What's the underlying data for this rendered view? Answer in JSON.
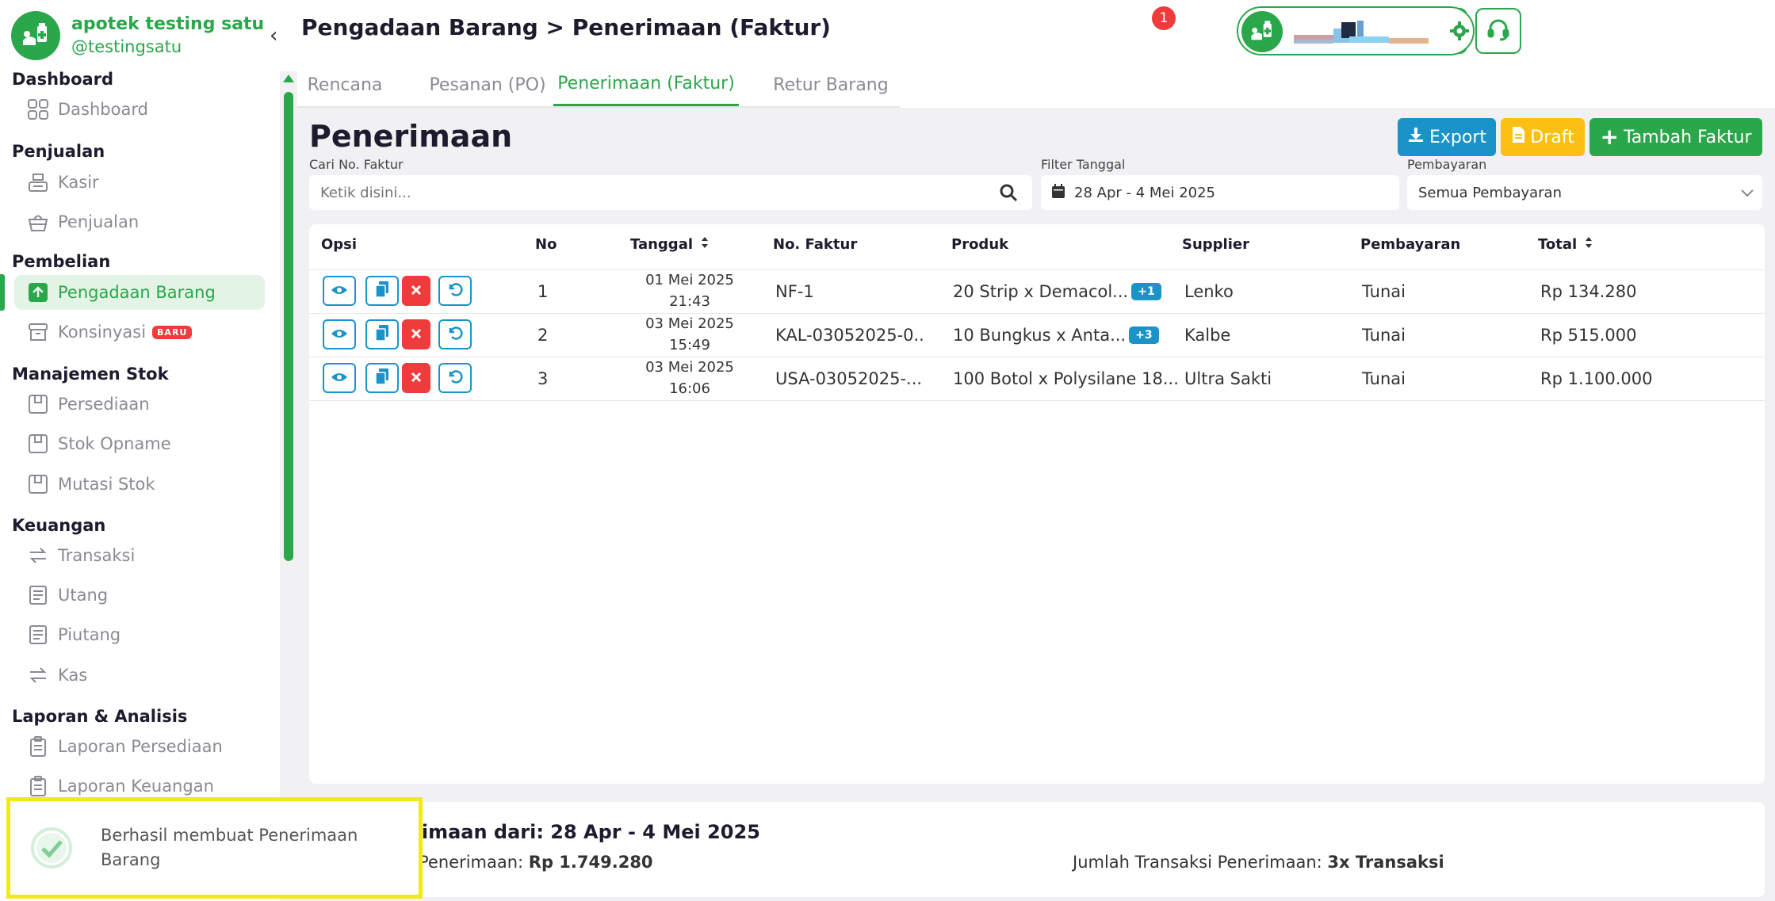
{
  "brand": {
    "name": "apotek testing satu",
    "handle": "@testingsatu"
  },
  "sidebar": {
    "sections": [
      {
        "title": "Dashboard",
        "items": [
          {
            "label": "Dashboard"
          }
        ]
      },
      {
        "title": "Penjualan",
        "items": [
          {
            "label": "Kasir"
          },
          {
            "label": "Penjualan"
          }
        ]
      },
      {
        "title": "Pembelian",
        "items": [
          {
            "label": "Pengadaan Barang",
            "active": true
          },
          {
            "label": "Konsinyasi",
            "badge": "BARU"
          }
        ]
      },
      {
        "title": "Manajemen Stok",
        "items": [
          {
            "label": "Persediaan"
          },
          {
            "label": "Stok Opname"
          },
          {
            "label": "Mutasi Stok"
          }
        ]
      },
      {
        "title": "Keuangan",
        "items": [
          {
            "label": "Transaksi"
          },
          {
            "label": "Utang"
          },
          {
            "label": "Piutang"
          },
          {
            "label": "Kas"
          }
        ]
      },
      {
        "title": "Laporan & Analisis",
        "items": [
          {
            "label": "Laporan Persediaan"
          },
          {
            "label": "Laporan Keuangan"
          }
        ]
      }
    ]
  },
  "header": {
    "breadcrumb": "Pengadaan Barang > Penerimaan (Faktur)",
    "notification_count": "1"
  },
  "tabs": [
    {
      "label": "Rencana"
    },
    {
      "label": "Pesanan (PO)"
    },
    {
      "label": "Penerimaan (Faktur)",
      "active": true
    },
    {
      "label": "Retur Barang"
    }
  ],
  "page": {
    "title": "Penerimaan",
    "actions": {
      "export": "Export",
      "draft": "Draft",
      "add": "Tambah Faktur"
    },
    "filters": {
      "search_label": "Cari No. Faktur",
      "search_placeholder": "Ketik disini...",
      "date_label": "Filter Tanggal",
      "date_value": "28 Apr - 4 Mei 2025",
      "payment_label": "Pembayaran",
      "payment_value": "Semua Pembayaran"
    }
  },
  "table": {
    "columns": [
      "Opsi",
      "No",
      "Tanggal",
      "No. Faktur",
      "Produk",
      "Supplier",
      "Pembayaran",
      "Total"
    ],
    "rows": [
      {
        "no": "1",
        "date": "01 Mei 2025",
        "time": "21:43",
        "invoice": "NF-1",
        "product": "20 Strip x Demacol...",
        "extra": "+1",
        "supplier": "Lenko",
        "payment": "Tunai",
        "total": "Rp 134.280"
      },
      {
        "no": "2",
        "date": "03 Mei 2025",
        "time": "15:49",
        "invoice": "KAL-03052025-0...",
        "product": "10 Bungkus x Anta...",
        "extra": "+3",
        "supplier": "Kalbe",
        "payment": "Tunai",
        "total": "Rp 515.000"
      },
      {
        "no": "3",
        "date": "03 Mei 2025",
        "time": "16:06",
        "invoice": "USA-03052025-...",
        "product": "100 Botol x Polysilane 18...",
        "extra": "",
        "supplier": "Ultra Sakti",
        "payment": "Tunai",
        "total": "Rp 1.100.000"
      }
    ]
  },
  "summary": {
    "title": "rimaan dari: 28 Apr - 4 Mei 2025",
    "total_label": "Penerimaan: ",
    "total_value": "Rp 1.749.280",
    "count_label": "Jumlah Transaksi Penerimaan: ",
    "count_value": "3x Transaksi"
  },
  "toast": {
    "message": "Berhasil membuat Penerimaan Barang"
  },
  "colors": {
    "primary": "#2aa74a",
    "info": "#1a94c8",
    "warning": "#fcbf14",
    "danger": "#ef3b3b",
    "highlight": "#f3ea13"
  }
}
